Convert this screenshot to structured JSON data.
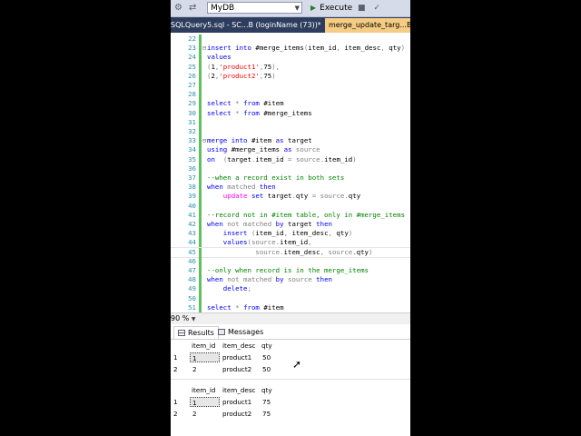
{
  "toolbar": {
    "database": "MyDB",
    "execute_label": "Execute"
  },
  "tabs": [
    {
      "label": "SQLQuery5.sql - SC...B (loginName (73))*"
    },
    {
      "label": "merge_update_targ...B (lo"
    }
  ],
  "editor": {
    "lines": [
      {
        "n": "22",
        "tokens": []
      },
      {
        "n": "23",
        "marker": "⊟",
        "tokens": [
          {
            "t": "insert into ",
            "c": "kw"
          },
          {
            "t": "#merge_items",
            "c": ""
          },
          {
            "t": "(",
            "c": "gr"
          },
          {
            "t": "item_id",
            "c": ""
          },
          {
            "t": ", ",
            "c": "gr"
          },
          {
            "t": "item_desc",
            "c": ""
          },
          {
            "t": ", ",
            "c": "gr"
          },
          {
            "t": "qty",
            "c": ""
          },
          {
            "t": ")",
            "c": "gr"
          }
        ]
      },
      {
        "n": "24",
        "tokens": [
          {
            "t": "values",
            "c": "kw"
          }
        ]
      },
      {
        "n": "25",
        "tokens": [
          {
            "t": "(",
            "c": "gr"
          },
          {
            "t": "1",
            "c": ""
          },
          {
            "t": ",",
            "c": "gr"
          },
          {
            "t": "'product1'",
            "c": "st"
          },
          {
            "t": ",",
            "c": "gr"
          },
          {
            "t": "75",
            "c": ""
          },
          {
            "t": "),",
            "c": "gr"
          }
        ]
      },
      {
        "n": "26",
        "tokens": [
          {
            "t": "(",
            "c": "gr"
          },
          {
            "t": "2",
            "c": ""
          },
          {
            "t": ",",
            "c": "gr"
          },
          {
            "t": "'product2'",
            "c": "st"
          },
          {
            "t": ",",
            "c": "gr"
          },
          {
            "t": "75",
            "c": ""
          },
          {
            "t": ")",
            "c": "gr"
          }
        ]
      },
      {
        "n": "27",
        "tokens": []
      },
      {
        "n": "28",
        "tokens": []
      },
      {
        "n": "29",
        "tokens": [
          {
            "t": "select ",
            "c": "kw"
          },
          {
            "t": "* ",
            "c": "gr"
          },
          {
            "t": "from ",
            "c": "kw"
          },
          {
            "t": "#item",
            "c": ""
          }
        ]
      },
      {
        "n": "30",
        "tokens": [
          {
            "t": "select ",
            "c": "kw"
          },
          {
            "t": "* ",
            "c": "gr"
          },
          {
            "t": "from ",
            "c": "kw"
          },
          {
            "t": "#merge_items",
            "c": ""
          }
        ]
      },
      {
        "n": "31",
        "tokens": []
      },
      {
        "n": "32",
        "tokens": []
      },
      {
        "n": "33",
        "marker": "⊟",
        "tokens": [
          {
            "t": "merge into ",
            "c": "kw"
          },
          {
            "t": "#item ",
            "c": ""
          },
          {
            "t": "as ",
            "c": "kw"
          },
          {
            "t": "target",
            "c": ""
          }
        ]
      },
      {
        "n": "34",
        "tokens": [
          {
            "t": "using ",
            "c": "kw"
          },
          {
            "t": "#merge_items ",
            "c": ""
          },
          {
            "t": "as ",
            "c": "kw"
          },
          {
            "t": "source",
            "c": "gr"
          }
        ]
      },
      {
        "n": "35",
        "tokens": [
          {
            "t": "on  ",
            "c": "kw"
          },
          {
            "t": "(",
            "c": "gr"
          },
          {
            "t": "target",
            "c": ""
          },
          {
            "t": ".",
            "c": "gr"
          },
          {
            "t": "item_id ",
            "c": ""
          },
          {
            "t": "= ",
            "c": "gr"
          },
          {
            "t": "source",
            "c": "gr"
          },
          {
            "t": ".",
            "c": "gr"
          },
          {
            "t": "item_id",
            "c": ""
          },
          {
            "t": ")",
            "c": "gr"
          }
        ]
      },
      {
        "n": "36",
        "tokens": []
      },
      {
        "n": "37",
        "tokens": [
          {
            "t": "--when a record exist in both sets",
            "c": "cm"
          }
        ]
      },
      {
        "n": "38",
        "tokens": [
          {
            "t": "when ",
            "c": "kw"
          },
          {
            "t": "matched ",
            "c": "gr"
          },
          {
            "t": "then",
            "c": "kw"
          }
        ]
      },
      {
        "n": "39",
        "tokens": [
          {
            "t": "    update ",
            "c": "pk"
          },
          {
            "t": "set ",
            "c": "kw"
          },
          {
            "t": "target",
            "c": ""
          },
          {
            "t": ".",
            "c": "gr"
          },
          {
            "t": "qty ",
            "c": ""
          },
          {
            "t": "= ",
            "c": "gr"
          },
          {
            "t": "source",
            "c": "gr"
          },
          {
            "t": ".",
            "c": "gr"
          },
          {
            "t": "qty",
            "c": ""
          }
        ]
      },
      {
        "n": "40",
        "tokens": []
      },
      {
        "n": "41",
        "tokens": [
          {
            "t": "--record not in #item table, only in #merge_items",
            "c": "cm"
          }
        ]
      },
      {
        "n": "42",
        "tokens": [
          {
            "t": "when ",
            "c": "kw"
          },
          {
            "t": "not matched ",
            "c": "gr"
          },
          {
            "t": "by ",
            "c": "kw"
          },
          {
            "t": "target ",
            "c": ""
          },
          {
            "t": "then",
            "c": "kw"
          }
        ]
      },
      {
        "n": "43",
        "tokens": [
          {
            "t": "    insert ",
            "c": "kw"
          },
          {
            "t": "(",
            "c": "gr"
          },
          {
            "t": "item_id",
            "c": ""
          },
          {
            "t": ", ",
            "c": "gr"
          },
          {
            "t": "item_desc",
            "c": ""
          },
          {
            "t": ", ",
            "c": "gr"
          },
          {
            "t": "qty",
            "c": ""
          },
          {
            "t": ")",
            "c": "gr"
          }
        ]
      },
      {
        "n": "44",
        "tokens": [
          {
            "t": "    values",
            "c": "kw"
          },
          {
            "t": "(",
            "c": "gr"
          },
          {
            "t": "source",
            "c": "gr"
          },
          {
            "t": ".",
            "c": "gr"
          },
          {
            "t": "item_id",
            "c": ""
          },
          {
            "t": ",",
            "c": "gr"
          }
        ]
      },
      {
        "n": "45",
        "current": true,
        "tokens": [
          {
            "t": "            source",
            "c": "gr"
          },
          {
            "t": ".",
            "c": "gr"
          },
          {
            "t": "item_desc",
            "c": ""
          },
          {
            "t": ", ",
            "c": "gr"
          },
          {
            "t": "source",
            "c": "gr"
          },
          {
            "t": ".",
            "c": "gr"
          },
          {
            "t": "qty",
            "c": ""
          },
          {
            "t": ")",
            "c": "gr"
          }
        ]
      },
      {
        "n": "46",
        "tokens": []
      },
      {
        "n": "47",
        "tokens": [
          {
            "t": "--only when record is in the merge_items",
            "c": "cm"
          }
        ]
      },
      {
        "n": "48",
        "tokens": [
          {
            "t": "when ",
            "c": "kw"
          },
          {
            "t": "not matched ",
            "c": "gr"
          },
          {
            "t": "by ",
            "c": "kw"
          },
          {
            "t": "source ",
            "c": "gr"
          },
          {
            "t": "then",
            "c": "kw"
          }
        ]
      },
      {
        "n": "49",
        "tokens": [
          {
            "t": "    delete",
            "c": "kw"
          },
          {
            "t": ";",
            "c": "gr"
          }
        ]
      },
      {
        "n": "50",
        "tokens": []
      },
      {
        "n": "51",
        "tokens": [
          {
            "t": "select ",
            "c": "kw"
          },
          {
            "t": "* ",
            "c": "gr"
          },
          {
            "t": "from ",
            "c": "kw"
          },
          {
            "t": "#item",
            "c": ""
          }
        ]
      }
    ]
  },
  "zoom": "90 %",
  "results_tabs": [
    {
      "label": "Results"
    },
    {
      "label": "Messages"
    }
  ],
  "grids": [
    {
      "headers": [
        "item_id",
        "item_desc",
        "qty"
      ],
      "rows": [
        {
          "no": "1",
          "cells": [
            "1",
            "product1",
            "50"
          ]
        },
        {
          "no": "2",
          "cells": [
            "2",
            "product2",
            "50"
          ]
        }
      ]
    },
    {
      "headers": [
        "item_id",
        "item_desc",
        "qty"
      ],
      "rows": [
        {
          "no": "1",
          "cells": [
            "1",
            "product1",
            "75"
          ]
        },
        {
          "no": "2",
          "cells": [
            "2",
            "product2",
            "75"
          ]
        }
      ]
    }
  ],
  "colors": {
    "keyword": "#0000ff",
    "string": "#ff0000",
    "comment": "#008000",
    "gray": "#808080",
    "tab_active": "#f5cc84",
    "tabbar": "#2e3d5e"
  }
}
